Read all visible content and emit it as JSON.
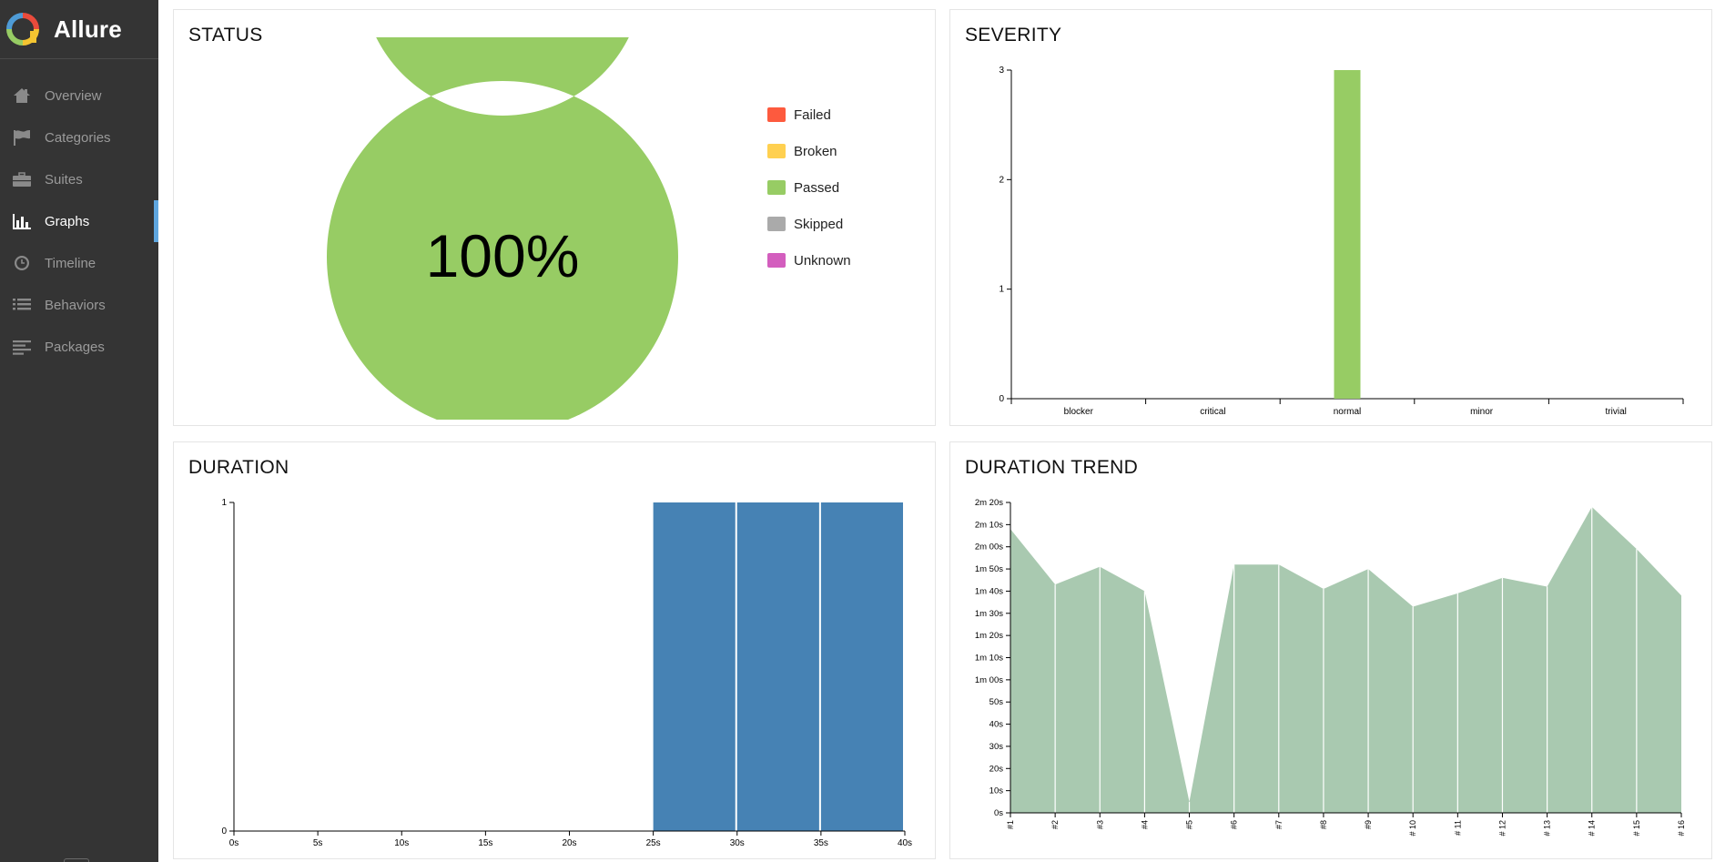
{
  "app": {
    "name": "Allure"
  },
  "nav": [
    {
      "id": "overview",
      "label": "Overview",
      "icon": "home-icon",
      "active": false
    },
    {
      "id": "categories",
      "label": "Categories",
      "icon": "flag-icon",
      "active": false
    },
    {
      "id": "suites",
      "label": "Suites",
      "icon": "briefcase-icon",
      "active": false
    },
    {
      "id": "graphs",
      "label": "Graphs",
      "icon": "bar-chart-icon",
      "active": true
    },
    {
      "id": "timeline",
      "label": "Timeline",
      "icon": "clock-icon",
      "active": false
    },
    {
      "id": "behaviors",
      "label": "Behaviors",
      "icon": "list-icon",
      "active": false
    },
    {
      "id": "packages",
      "label": "Packages",
      "icon": "align-left-icon",
      "active": false
    }
  ],
  "status": {
    "title": "STATUS",
    "percent_label": "100%",
    "legend": [
      {
        "label": "Failed",
        "color": "#fd5a3e"
      },
      {
        "label": "Broken",
        "color": "#ffd050"
      },
      {
        "label": "Passed",
        "color": "#97cc64"
      },
      {
        "label": "Skipped",
        "color": "#aaaaaa"
      },
      {
        "label": "Unknown",
        "color": "#d35ebe"
      }
    ]
  },
  "severity": {
    "title": "SEVERITY"
  },
  "duration": {
    "title": "DURATION"
  },
  "trend": {
    "title": "DURATION TREND"
  },
  "chart_data": [
    {
      "type": "pie",
      "title": "STATUS",
      "categories": [
        "Failed",
        "Broken",
        "Passed",
        "Skipped",
        "Unknown"
      ],
      "values": [
        0,
        0,
        100,
        0,
        0
      ],
      "colors": [
        "#fd5a3e",
        "#ffd050",
        "#97cc64",
        "#aaaaaa",
        "#d35ebe"
      ],
      "center_label": "100%",
      "legend": "right"
    },
    {
      "type": "bar",
      "title": "SEVERITY",
      "categories": [
        "blocker",
        "critical",
        "normal",
        "minor",
        "trivial"
      ],
      "values": [
        0,
        0,
        3,
        0,
        0
      ],
      "yticks": [
        0,
        1,
        2,
        3
      ],
      "ylim": [
        0,
        3
      ],
      "color": "#97cc64"
    },
    {
      "type": "bar",
      "title": "DURATION",
      "xticks": [
        "0s",
        "5s",
        "10s",
        "15s",
        "20s",
        "25s",
        "30s",
        "35s",
        "40s"
      ],
      "xlim": [
        0,
        40
      ],
      "bins": [
        {
          "x0": 25,
          "x1": 30,
          "value": 1
        },
        {
          "x0": 30,
          "x1": 35,
          "value": 1
        },
        {
          "x0": 35,
          "x1": 40,
          "value": 1
        }
      ],
      "yticks": [
        0,
        1
      ],
      "ylim": [
        0,
        1
      ],
      "color": "#4682b4"
    },
    {
      "type": "area",
      "title": "DURATION TREND",
      "categories": [
        "#1",
        "#2",
        "#3",
        "#4",
        "#5",
        "#6",
        "#7",
        "#8",
        "#9",
        "# 10",
        "# 11",
        "# 12",
        "# 13",
        "# 14",
        "# 15",
        "# 16"
      ],
      "values": [
        128,
        103,
        111,
        100,
        5,
        112,
        112,
        101,
        110,
        93,
        99,
        106,
        102,
        138,
        119,
        98
      ],
      "unit": "seconds",
      "yticks": [
        "0s",
        "10s",
        "20s",
        "30s",
        "40s",
        "50s",
        "1m 00s",
        "1m 10s",
        "1m 20s",
        "1m 30s",
        "1m 40s",
        "1m 50s",
        "2m 00s",
        "2m 10s",
        "2m 20s"
      ],
      "ylim": [
        0,
        140
      ],
      "color": "#a9c9b0"
    }
  ]
}
